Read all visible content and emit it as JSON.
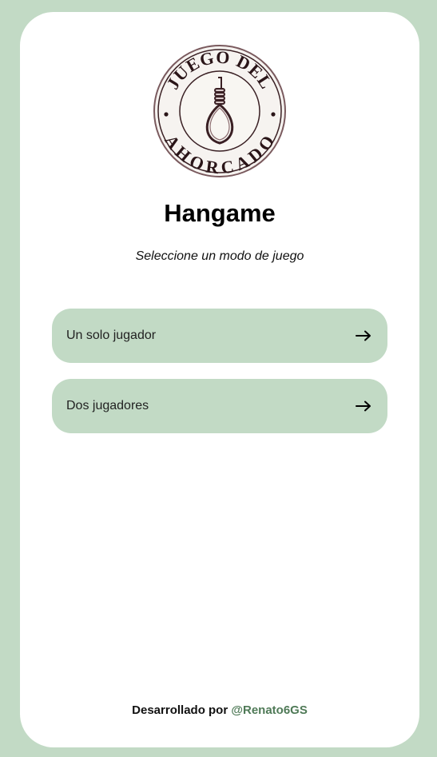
{
  "logo": {
    "text_top": "JUEGO DEL",
    "text_bottom": "AHORCADO",
    "icon": "noose-icon"
  },
  "header": {
    "title": "Hangame",
    "subtitle": "Seleccione un modo de juego"
  },
  "modes": [
    {
      "label": "Un solo jugador",
      "icon": "arrow-right-icon"
    },
    {
      "label": "Dos jugadores",
      "icon": "arrow-right-icon"
    }
  ],
  "footer": {
    "prefix": "Desarrollado por",
    "author": "@Renato6GS"
  },
  "colors": {
    "background": "#c2dac5",
    "card": "#ffffff",
    "button": "#c2dac5",
    "link": "#4f7a57",
    "logo_ink": "#3a2024"
  }
}
